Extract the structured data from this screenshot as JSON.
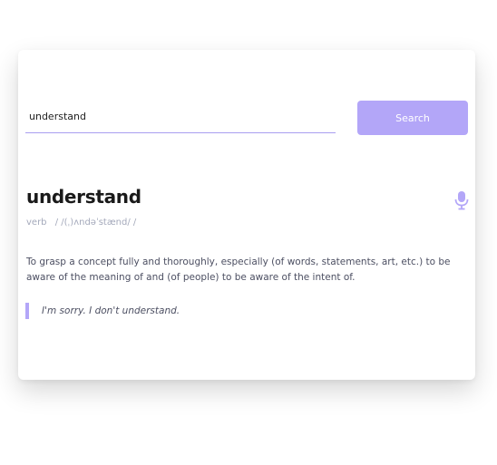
{
  "search": {
    "value": "understand",
    "button_label": "Search"
  },
  "entry": {
    "word": "understand",
    "part_of_speech": "verb",
    "phonetic": "/ /(ˌ)ʌndəˈstænd/ /",
    "definition": "To grasp a concept fully and thoroughly, especially (of words, statements, art, etc.) to be aware of the meaning of and (of people) to be aware of the intent of.",
    "example": "I'm sorry. I don't understand."
  },
  "icons": {
    "audio": "microphone-icon"
  },
  "colors": {
    "accent": "#b3a6f8",
    "input_underline": "#a99ef0",
    "muted_text": "#a4a9bb",
    "body_text": "#4c4f62"
  }
}
